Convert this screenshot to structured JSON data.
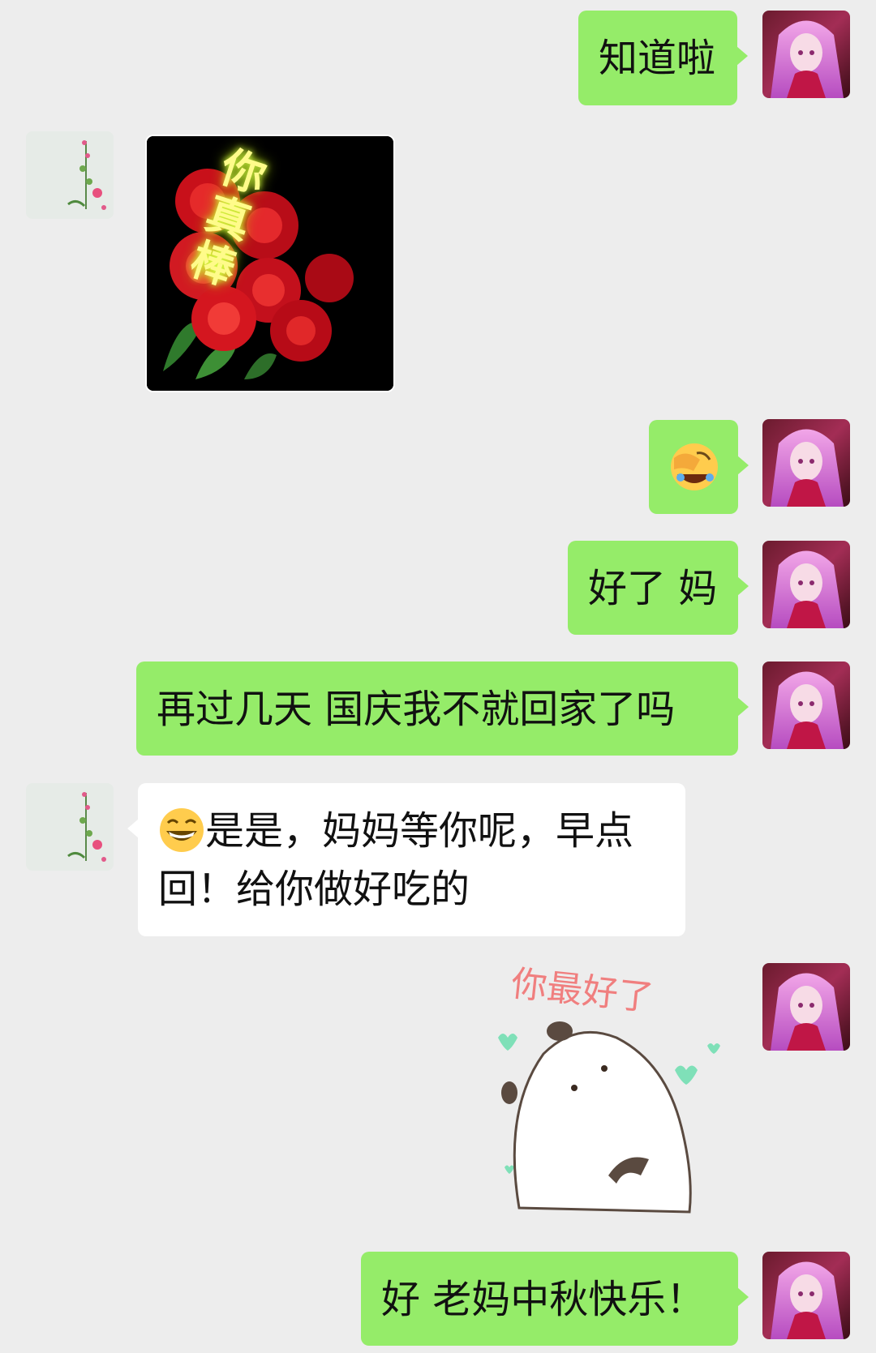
{
  "colors": {
    "background": "#ededed",
    "sent_bubble": "#95ec69",
    "received_bubble": "#ffffff"
  },
  "messages": [
    {
      "side": "right",
      "type": "text",
      "text": "知道啦"
    },
    {
      "side": "left",
      "type": "sticker",
      "sticker": "roses-sticker",
      "sticker_text": "你真棒"
    },
    {
      "side": "right",
      "type": "emoji",
      "emoji": "facepalm-laugh-emoji"
    },
    {
      "side": "right",
      "type": "text",
      "text": "好了 妈"
    },
    {
      "side": "right",
      "type": "text",
      "text": "再过几天 国庆我不就回家了吗"
    },
    {
      "side": "left",
      "type": "text",
      "emoji": "grin-emoji",
      "line1": "是是，妈妈等你呢，早点",
      "line2": "回！给你做好吃的"
    },
    {
      "side": "right",
      "type": "sticker",
      "sticker": "panda-sticker",
      "sticker_text": "你最好了"
    },
    {
      "side": "right",
      "type": "text",
      "text": "好 老妈中秋快乐！"
    }
  ]
}
